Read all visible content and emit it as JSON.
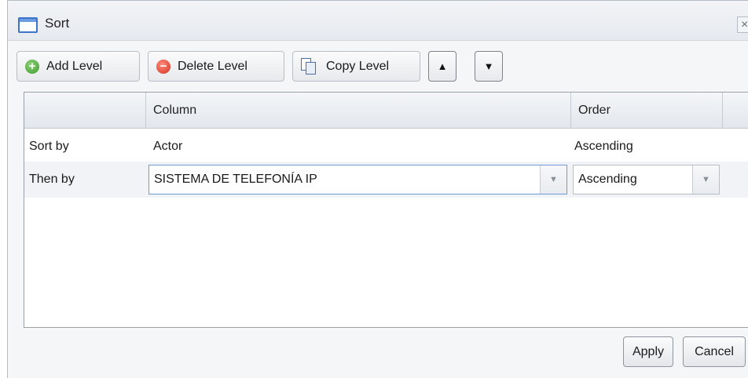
{
  "dialog": {
    "title": "Sort",
    "close_glyph": "×"
  },
  "toolbar": {
    "add_level": "Add Level",
    "delete_level": "Delete Level",
    "copy_level": "Copy Level",
    "move_up_glyph": "▲",
    "move_down_glyph": "▼",
    "add_icon_glyph": "+",
    "delete_icon_glyph": "−"
  },
  "grid": {
    "columns": [
      "",
      "Column",
      "Order"
    ],
    "rows": [
      {
        "label": "Sort by",
        "column": "Actor",
        "order": "Ascending"
      },
      {
        "label": "Then by",
        "column": "SISTEMA DE TELEFONÍA IP",
        "order": "Ascending"
      }
    ],
    "dropdown_glyph": "▼"
  },
  "footer": {
    "apply": "Apply",
    "cancel": "Cancel"
  },
  "colors": {
    "accent": "#3b74c9",
    "focus_border": "#6f9ad6"
  }
}
